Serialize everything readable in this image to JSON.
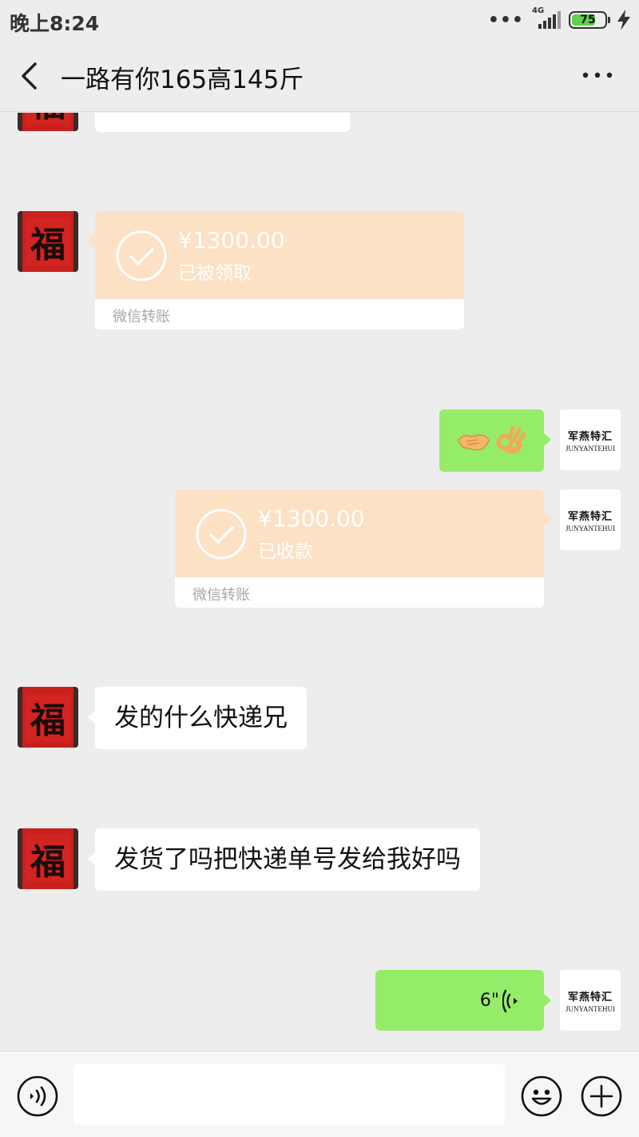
{
  "status_bar": {
    "time": "晚上8:24",
    "network": "4G",
    "battery_percent": "75",
    "battery_level": 0.75,
    "icons": [
      "more-dots-icon",
      "signal-icon",
      "battery-icon",
      "charging-bolt-icon"
    ]
  },
  "header": {
    "title": "一路有你165高145斤",
    "icons": [
      "back-arrow-icon",
      "more-icon"
    ]
  },
  "messages": [
    {
      "side": "in",
      "type": "text",
      "text": ""
    },
    {
      "side": "in",
      "type": "transfer",
      "amount": "¥1300.00",
      "status": "已被领取",
      "footer": "微信转账"
    },
    {
      "side": "out",
      "type": "emoji",
      "emoji": [
        "handshake-emoji",
        "ok-hand-emoji"
      ]
    },
    {
      "side": "out",
      "type": "transfer",
      "amount": "¥1300.00",
      "status": "已收款",
      "footer": "微信转账"
    },
    {
      "side": "in",
      "type": "text",
      "text": "发的什么快递兄"
    },
    {
      "side": "in",
      "type": "text",
      "text": "发货了吗把快递单号发给我好吗"
    },
    {
      "side": "out",
      "type": "voice",
      "duration": "6\""
    }
  ],
  "avatars": {
    "contact": {
      "label": "福"
    },
    "self": {
      "label_cn": "军燕特汇",
      "label_en": "JUNYANTEHUI"
    }
  },
  "input_bar": {
    "value": "",
    "icons": [
      "voice-input-icon",
      "emoji-icon",
      "plus-icon"
    ]
  },
  "colors": {
    "background": "#ededed",
    "incoming_bubble": "#ffffff",
    "outgoing_bubble": "#95ec69",
    "transfer_card": "#fce1c4"
  }
}
